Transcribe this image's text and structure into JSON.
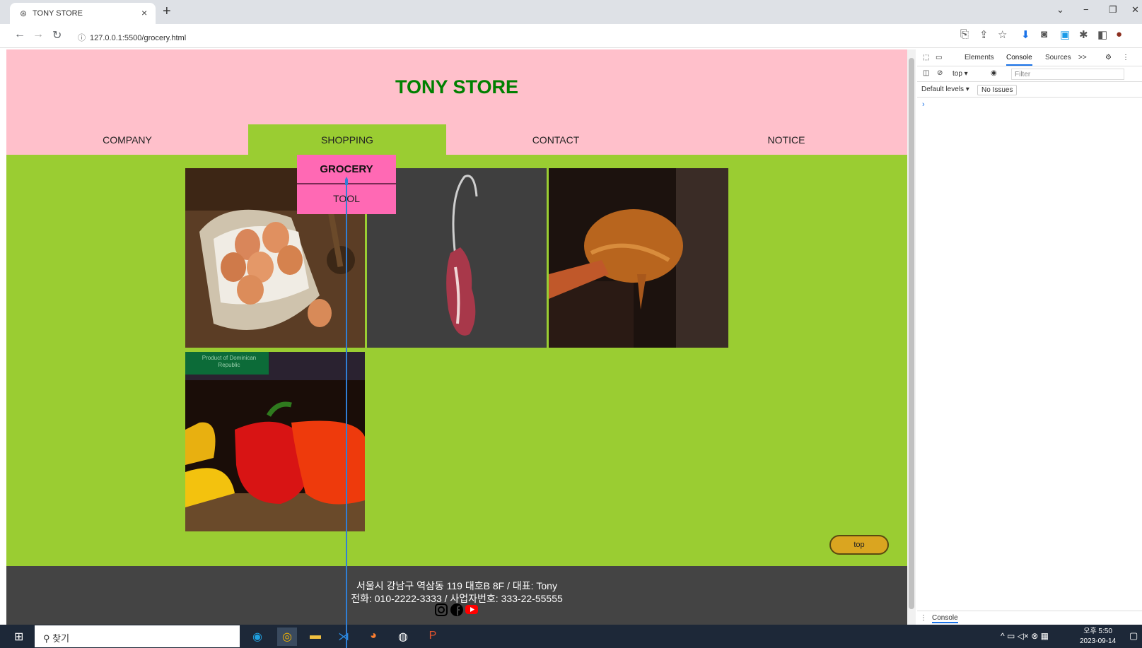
{
  "browser": {
    "tab_title": "TONY STORE",
    "tab_close": "×",
    "new_tab": "+",
    "url": "127.0.0.1:5500/grocery.html",
    "window_controls": [
      "⌄",
      "−",
      "❐",
      "✕"
    ]
  },
  "site": {
    "title": "TONY STORE",
    "nav": [
      "COMPANY",
      "SHOPPING",
      "CONTACT",
      "NOTICE"
    ],
    "active_nav": "SHOPPING",
    "dropdown": [
      "GROCERY",
      "TOOL"
    ],
    "images": [
      {
        "name": "eggs-image",
        "alt": "eggs in cloth bag"
      },
      {
        "name": "meat-image",
        "alt": "meat on hook"
      },
      {
        "name": "sauce-image",
        "alt": "sauce on spoon"
      },
      {
        "name": "peppers-image",
        "alt": "bell peppers",
        "overlay_text": "Product of Dominican Republic"
      }
    ],
    "top_button": "top",
    "footer": {
      "line1": "서울시 강남구 역삼동 119 대호B 8F / 대표: Tony",
      "line2": "전화: 010-2222-3333 / 사업자번호: 333-22-55555",
      "social_icons": [
        "instagram-icon",
        "facebook-icon",
        "youtube-icon"
      ]
    }
  },
  "devtools": {
    "tabs": [
      "Elements",
      "Console",
      "Sources",
      ">>"
    ],
    "active_tab": "Console",
    "context": "top",
    "filter_placeholder": "Filter",
    "levels": "Default levels ▾",
    "issues": "No Issues",
    "prompt": "›",
    "drawer_tab": "Console"
  },
  "taskbar": {
    "search_text": "찾기",
    "time": "오후 5:50",
    "date": "2023-09-14"
  },
  "colors": {
    "header_bg": "#ffc0cb",
    "page_bg": "#9acd32",
    "title_color": "#008000",
    "dropdown_bg": "#ff69b4",
    "footer_bg": "#444444",
    "top_button_bg": "#daa520"
  }
}
